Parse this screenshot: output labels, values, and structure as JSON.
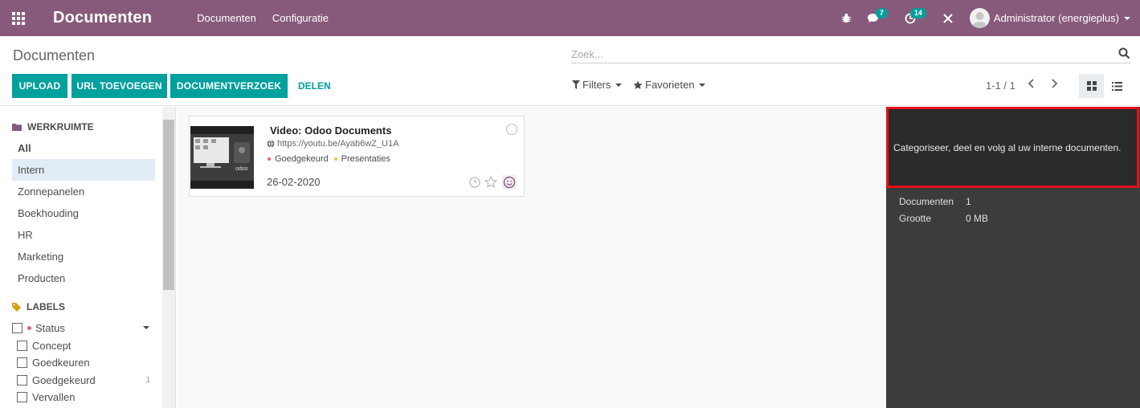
{
  "navbar": {
    "app_title": "Documenten",
    "menus": [
      "Documenten",
      "Configuratie"
    ],
    "chat_badge": "7",
    "activity_badge": "14",
    "user_name": "Administrator (energieplus)",
    "bg_color": "#875a7b"
  },
  "control_panel": {
    "breadcrumb": "Documenten",
    "search_placeholder": "Zoek...",
    "buttons": {
      "upload": "UPLOAD",
      "add_url": "URL TOEVOEGEN",
      "request": "DOCUMENTVERZOEK",
      "share": "DELEN"
    },
    "filters_label": "Filters",
    "favorites_label": "Favorieten",
    "pager": "1-1 / 1",
    "accent_color": "#00a09d"
  },
  "sidebar": {
    "workspace_title": "WERKRUIMTE",
    "folders": [
      {
        "label": "All"
      },
      {
        "label": "Intern"
      },
      {
        "label": "Zonnepanelen"
      },
      {
        "label": "Boekhouding"
      },
      {
        "label": "HR"
      },
      {
        "label": "Marketing"
      },
      {
        "label": "Producten"
      }
    ],
    "labels_title": "LABELS",
    "status_facet": "Status",
    "tags": [
      {
        "label": "Concept",
        "count": ""
      },
      {
        "label": "Goedkeuren",
        "count": ""
      },
      {
        "label": "Goedgekeurd",
        "count": "1"
      },
      {
        "label": "Vervallen",
        "count": ""
      }
    ]
  },
  "documents": [
    {
      "title": "Video: Odoo Documents",
      "url": "https://youtu.be/Ayab6wZ_U1A",
      "tags": [
        {
          "label": "Goedgekeurd",
          "color": "#e06666"
        },
        {
          "label": "Presentaties",
          "color": "#f1c232"
        }
      ],
      "date": "26-02-2020",
      "thumb_text": "odoo"
    }
  ],
  "inspector": {
    "help_text": "Categoriseer, deel en volg al uw interne documenten.",
    "stats": [
      {
        "label": "Documenten",
        "value": "1"
      },
      {
        "label": "Grootte",
        "value": "0 MB"
      }
    ],
    "highlight_color": "#e3101c"
  }
}
